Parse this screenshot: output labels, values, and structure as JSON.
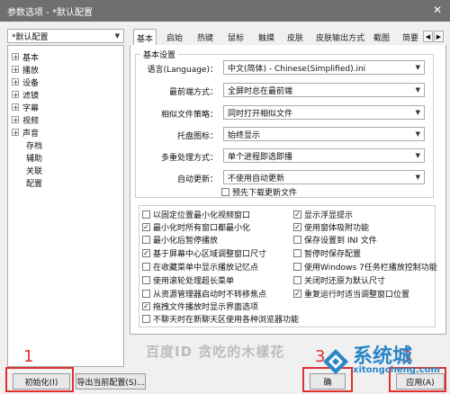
{
  "window": {
    "title": "参数选项 - *默认配置",
    "close_glyph": "✕"
  },
  "profile_combo": "*默认配置",
  "tree": {
    "expandable": [
      "基本",
      "播放",
      "设备",
      "滤镜",
      "字幕",
      "视频",
      "声音"
    ],
    "leaves": [
      "存档",
      "辅助",
      "关联",
      "配置"
    ]
  },
  "tabs": [
    "基本",
    "启始",
    "热键",
    "鼠标",
    "触摸",
    "皮肤",
    "皮肤输出方式",
    "截图",
    "简要"
  ],
  "tab_scroll": [
    "◀",
    "▶"
  ],
  "basic": {
    "group_title": "基本设置",
    "rows": [
      {
        "label": "语言(Language)：",
        "value": "中文(简体) - Chinese(Simplified).ini"
      },
      {
        "label": "最前端方式：",
        "value": "全屏时总在最前端"
      },
      {
        "label": "相似文件策略：",
        "value": "同时打开相似文件"
      },
      {
        "label": "托盘图标：",
        "value": "始终显示"
      },
      {
        "label": "多重处理方式：",
        "value": "单个进程即选即播"
      },
      {
        "label": "自动更新：",
        "value": "不使用自动更新"
      }
    ],
    "predownload": {
      "label": "预先下载更新文件",
      "checked": false
    }
  },
  "options_left": [
    {
      "label": "以固定位置最小化视频窗口",
      "checked": false
    },
    {
      "label": "最小化时所有窗口都最小化",
      "checked": true
    },
    {
      "label": "最小化后暂停播放",
      "checked": false
    },
    {
      "label": "基于屏幕中心区域调整窗口尺寸",
      "checked": true
    },
    {
      "label": "在收藏菜单中显示播放记忆点",
      "checked": false
    },
    {
      "label": "使用滚轮处理超长菜单",
      "checked": false
    },
    {
      "label": "从资源管理器启动时不转移焦点",
      "checked": false
    },
    {
      "label": "拖拽文件播放时显示界面选项",
      "checked": true
    },
    {
      "label": "不聊天时在新聊天区使用各种浏览器功能",
      "checked": false
    }
  ],
  "options_right": [
    {
      "label": "显示浮显提示",
      "checked": true
    },
    {
      "label": "使用窗体吸附功能",
      "checked": true
    },
    {
      "label": "保存设置到 INI 文件",
      "checked": false
    },
    {
      "label": "暂停时保存配置",
      "checked": false
    },
    {
      "label": "使用Windows 7任务栏播放控制功能",
      "checked": false
    },
    {
      "label": "关闭时还原为默认尺寸",
      "checked": false
    },
    {
      "label": "重复运行时适当调整窗口位置",
      "checked": true
    }
  ],
  "buttons": {
    "init": "初始化(I)",
    "export": "导出当前配置(S)...",
    "confirm": "确",
    "apply": "应用(A)"
  },
  "annotations": [
    "1",
    "3",
    "3"
  ],
  "watermarks": {
    "left": "百度ID 贪吃的木樣花",
    "brand": "系统城",
    "url": "xitongcheng.com"
  },
  "colors": {
    "title_bar": "#6f6f6f",
    "annotation_red": "#e03030",
    "watermark_blue": "#2a86c8"
  }
}
